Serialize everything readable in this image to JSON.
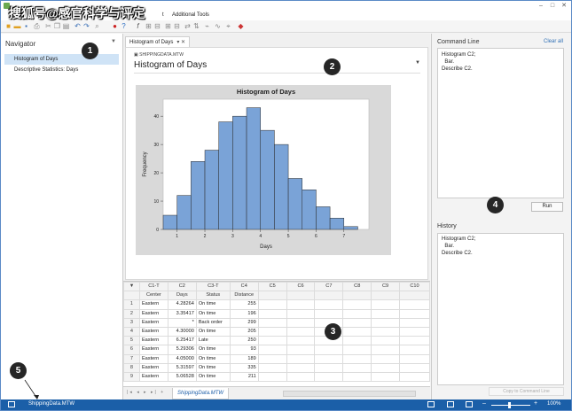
{
  "watermark": "搜狐号@感官科学与评定",
  "menu": {
    "item_a": "t",
    "item_b": "Additional Tools"
  },
  "navigator": {
    "title": "Navigator",
    "items": [
      {
        "label": "Histogram of Days"
      },
      {
        "label": "Descriptive Statistics: Days"
      }
    ]
  },
  "output": {
    "tab_label": "Histogram of Days",
    "worksheet": "SHIPPINGDATA.MTW",
    "title": "Histogram of Days"
  },
  "chart_data": {
    "type": "bar",
    "title": "Histogram of Days",
    "xlabel": "Days",
    "ylabel": "Frequency",
    "bin_start": 0.5,
    "bin_width": 0.5,
    "values": [
      5,
      12,
      24,
      28,
      38,
      40,
      43,
      35,
      30,
      18,
      14,
      8,
      4,
      1
    ],
    "xticks": [
      1,
      2,
      3,
      4,
      5,
      6,
      7
    ],
    "yticks": [
      0,
      10,
      20,
      30,
      40
    ],
    "xlim": [
      0.5,
      7.9
    ],
    "ylim": [
      0,
      46
    ],
    "bar_color": "#7aa3d7"
  },
  "worksheet": {
    "col_ids": [
      "C1-T",
      "C2",
      "C3-T",
      "C4",
      "C5",
      "C6",
      "C7",
      "C8",
      "C9",
      "C10"
    ],
    "col_names": [
      "Center",
      "Days",
      "Status",
      "Distance",
      "",
      "",
      "",
      "",
      "",
      ""
    ],
    "rows": [
      [
        "1",
        "Eastern",
        "4.28264",
        "On time",
        "255"
      ],
      [
        "2",
        "Eastern",
        "3.35417",
        "On time",
        "196"
      ],
      [
        "3",
        "Eastern",
        "*",
        "Back order",
        "299"
      ],
      [
        "4",
        "Eastern",
        "4.30000",
        "On time",
        "205"
      ],
      [
        "5",
        "Eastern",
        "6.25417",
        "Late",
        "250"
      ],
      [
        "6",
        "Eastern",
        "5.29306",
        "On time",
        "93"
      ],
      [
        "7",
        "Eastern",
        "4.05000",
        "On time",
        "189"
      ],
      [
        "8",
        "Eastern",
        "5.31597",
        "On time",
        "335"
      ],
      [
        "9",
        "Eastern",
        "5.06528",
        "On time",
        "211"
      ]
    ],
    "tab": "ShippingData.MTW"
  },
  "command_line": {
    "title": "Command Line",
    "clear": "Clear all",
    "lines": [
      "Histogram C2;",
      "  Bar.",
      "Describe C2."
    ],
    "run": "Run"
  },
  "history": {
    "title": "History",
    "lines": [
      "Histogram C2;",
      "  Bar.",
      "Describe C2."
    ],
    "copy": "Copy to Command Line"
  },
  "status": {
    "file": "ShippingData.MTW",
    "zoom": "100%"
  },
  "callouts": [
    "1",
    "2",
    "3",
    "4",
    "5"
  ]
}
